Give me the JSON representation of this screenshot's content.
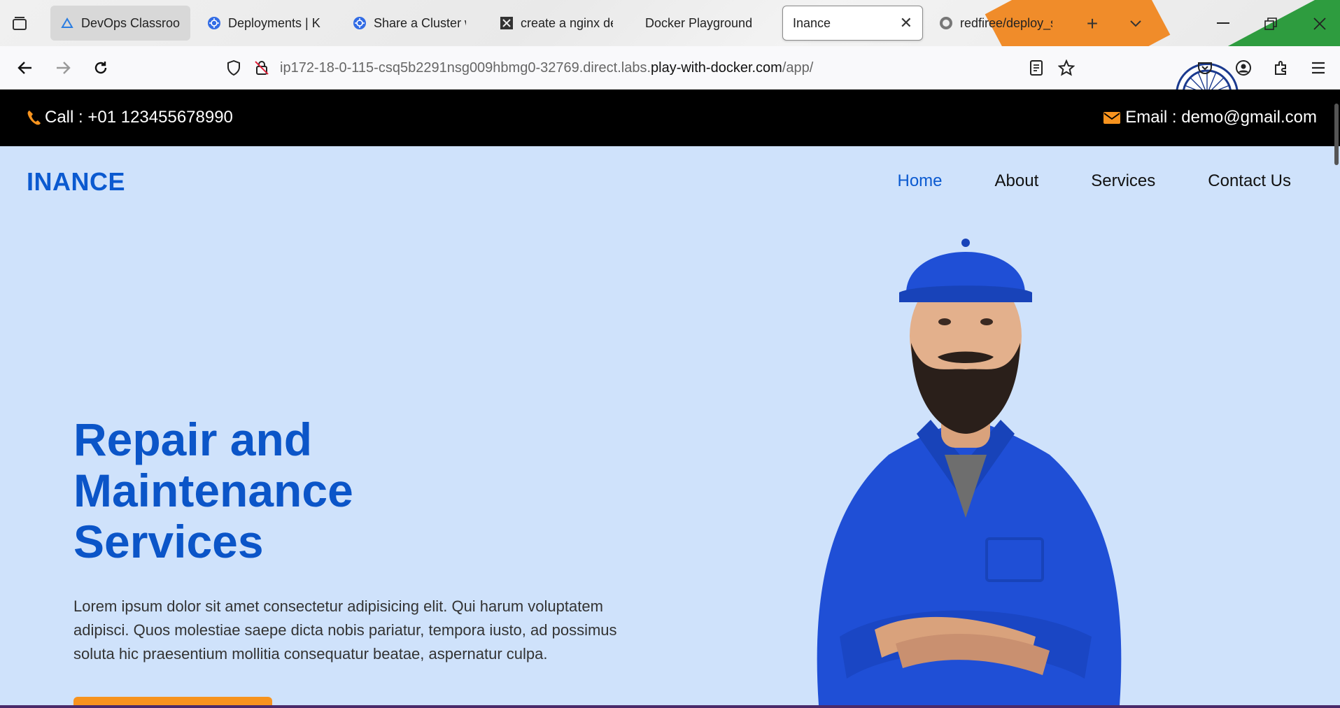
{
  "browser": {
    "tabs": [
      {
        "title": "DevOps Classroo",
        "favicon": "devops-favicon"
      },
      {
        "title": "Deployments | Ku",
        "favicon": "kubernetes-favicon"
      },
      {
        "title": "Share a Cluster w",
        "favicon": "kubernetes-favicon"
      },
      {
        "title": "create a nginx de",
        "favicon": "killercoda-favicon"
      },
      {
        "title": "Docker Playground",
        "favicon": ""
      },
      {
        "title": "Inance",
        "favicon": ""
      },
      {
        "title": "redfiree/deploy_s",
        "favicon": "github-favicon"
      }
    ],
    "active_tab_index": 5,
    "url_prefix": "ip172-18-0-115-csq5b2291nsg009hbmg0-32769.direct.labs.",
    "url_host": "play-with-docker.com",
    "url_path": "/app/",
    "colors": {
      "flag_orange": "#f08c2a",
      "flag_green": "#2e9c3f"
    }
  },
  "site": {
    "call_text": "Call : +01 123455678990",
    "email_text": "Email : demo@gmail.com",
    "brand": "INANCE",
    "menu": [
      "Home",
      "About",
      "Services",
      "Contact Us"
    ],
    "menu_active": "Home",
    "hero_title_lines": [
      "Repair and",
      "Maintenance",
      "Services"
    ],
    "hero_text": "Lorem ipsum dolor sit amet consectetur adipisicing elit. Qui harum voluptatem adipisci. Quos molestiae saepe dicta nobis pariatur, tempora iusto, ad possimus soluta hic praesentium mollitia consequatur beatae, aspernatur culpa.",
    "colors": {
      "accent": "#0b5ad0",
      "icon_orange": "#f7931e",
      "hero_bg": "#cfe2fb",
      "topbar_bg": "#000000"
    }
  }
}
